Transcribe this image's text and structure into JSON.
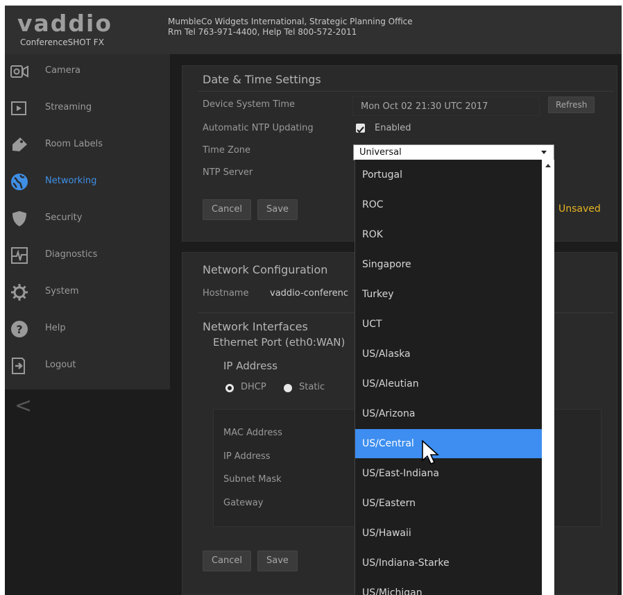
{
  "header": {
    "logo_text": "vaddio",
    "product": "ConferenceSHOT FX",
    "line1": "MumbleCo Widgets International, Strategic Planning Office",
    "line2": "Rm Tel 763-971-4400, Help Tel 800-572-2011"
  },
  "sidebar": {
    "items": [
      {
        "label": "Camera",
        "icon": "camera-icon"
      },
      {
        "label": "Streaming",
        "icon": "streaming-icon"
      },
      {
        "label": "Room Labels",
        "icon": "tag-icon"
      },
      {
        "label": "Networking",
        "icon": "globe-icon"
      },
      {
        "label": "Security",
        "icon": "shield-icon"
      },
      {
        "label": "Diagnostics",
        "icon": "pulse-icon"
      },
      {
        "label": "System",
        "icon": "gear-icon"
      },
      {
        "label": "Help",
        "icon": "help-icon"
      },
      {
        "label": "Logout",
        "icon": "logout-icon"
      }
    ],
    "active": "Networking",
    "collapse_glyph": "<"
  },
  "datetime": {
    "title": "Date & Time Settings",
    "device_time_label": "Device System Time",
    "device_time_value": "Mon Oct 02 21:30 UTC 2017",
    "refresh_label": "Refresh",
    "ntp_label": "Automatic NTP Updating",
    "ntp_value": "Enabled",
    "timezone_label": "Time Zone",
    "timezone_value": "Universal",
    "ntp_server_label": "NTP Server",
    "cancel_label": "Cancel",
    "save_label": "Save",
    "unsaved_label": "Unsaved"
  },
  "network": {
    "title": "Network Configuration",
    "hostname_label": "Hostname",
    "hostname_value": "vaddio-conferenc",
    "interfaces_title": "Network Interfaces",
    "port_title": "Ethernet Port (eth0:WAN)",
    "ip_address_title": "IP Address",
    "dhcp_label": "DHCP",
    "static_label": "Static",
    "mac_label": "MAC Address",
    "ip_label": "IP Address",
    "subnet_label": "Subnet Mask",
    "gateway_label": "Gateway",
    "cancel_label": "Cancel",
    "save_label": "Save"
  },
  "timezone_dropdown": {
    "options": [
      "Portugal",
      "ROC",
      "ROK",
      "Singapore",
      "Turkey",
      "UCT",
      "US/Alaska",
      "US/Aleutian",
      "US/Arizona",
      "US/Central",
      "US/East-Indiana",
      "US/Eastern",
      "US/Hawaii",
      "US/Indiana-Starke",
      "US/Michigan"
    ],
    "highlighted": "US/Central"
  },
  "colors": {
    "accent": "#3d8ef0",
    "active_nav": "#3f8fe6",
    "unsaved": "#e6b422"
  }
}
